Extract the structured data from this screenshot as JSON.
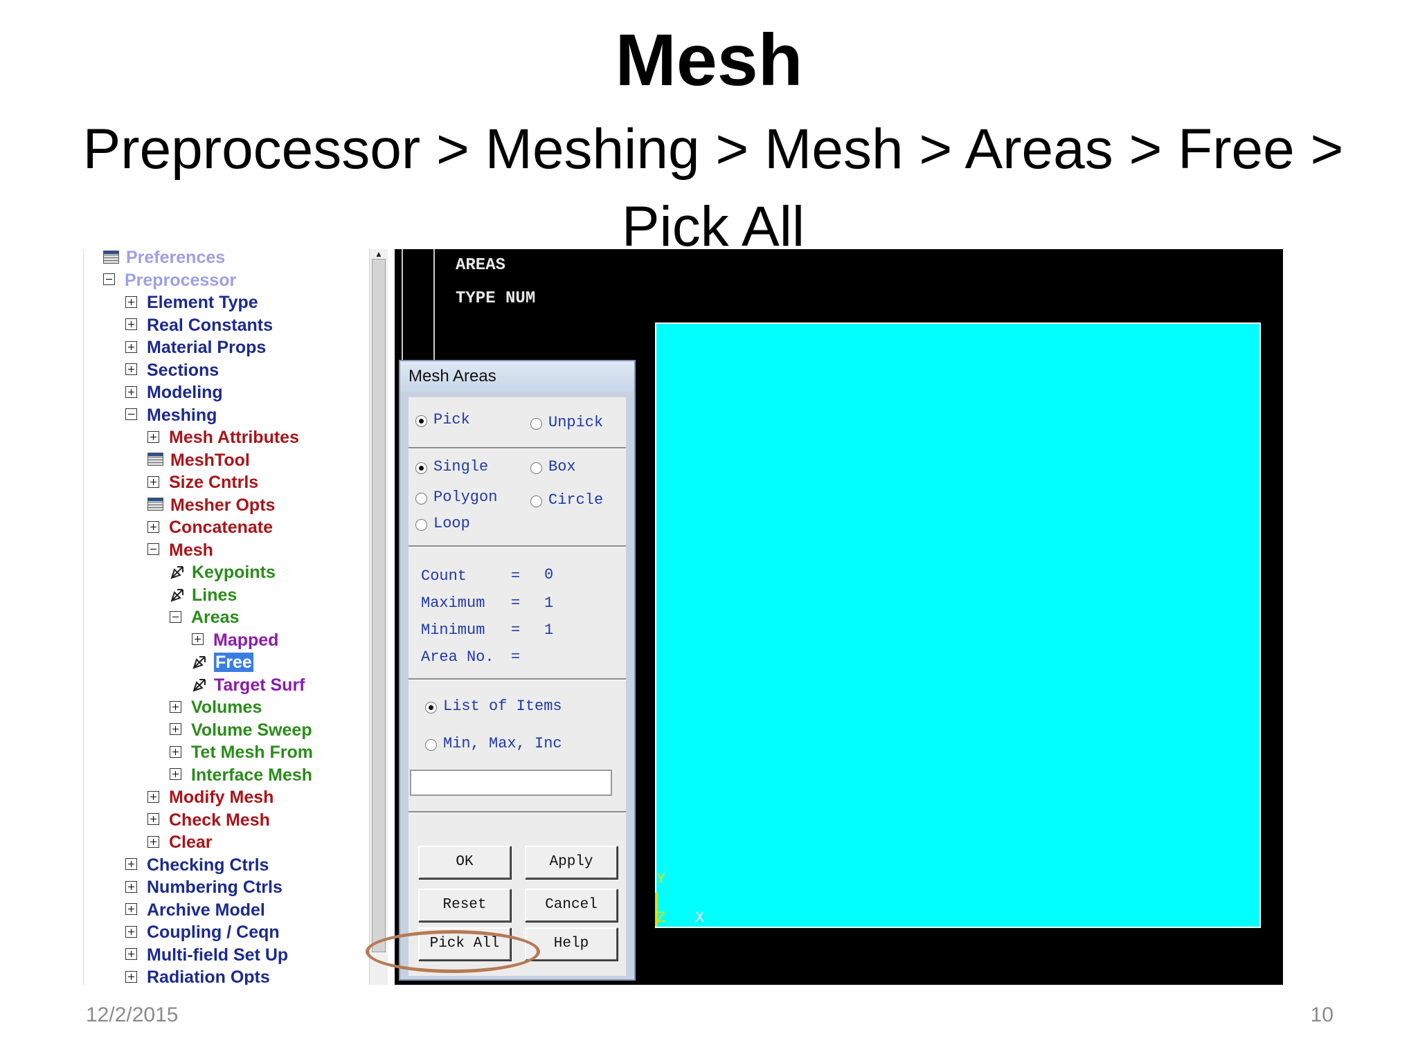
{
  "slide": {
    "title": "Mesh",
    "subtitle": "Preprocessor > Meshing > Mesh > Areas > Free > Pick All",
    "date": "12/2/2015",
    "page_number": "10"
  },
  "tree": {
    "items": [
      {
        "label": "Preferences",
        "icon": "tool-icon",
        "color": "lavender"
      },
      {
        "label": "Preprocessor",
        "icon": "minus-box-icon",
        "color": "lavender"
      },
      {
        "label": "Element Type",
        "icon": "plus-box-icon",
        "color": "navy"
      },
      {
        "label": "Real Constants",
        "icon": "plus-box-icon",
        "color": "navy"
      },
      {
        "label": "Material Props",
        "icon": "plus-box-icon",
        "color": "navy"
      },
      {
        "label": "Sections",
        "icon": "plus-box-icon",
        "color": "navy"
      },
      {
        "label": "Modeling",
        "icon": "plus-box-icon",
        "color": "navy"
      },
      {
        "label": "Meshing",
        "icon": "minus-box-icon",
        "color": "navy"
      },
      {
        "label": "Mesh Attributes",
        "icon": "plus-box-icon",
        "color": "red"
      },
      {
        "label": "MeshTool",
        "icon": "tool-icon",
        "color": "red"
      },
      {
        "label": "Size Cntrls",
        "icon": "plus-box-icon",
        "color": "red"
      },
      {
        "label": "Mesher Opts",
        "icon": "tool-icon",
        "color": "red"
      },
      {
        "label": "Concatenate",
        "icon": "plus-box-icon",
        "color": "red"
      },
      {
        "label": "Mesh",
        "icon": "minus-box-icon",
        "color": "red"
      },
      {
        "label": "Keypoints",
        "icon": "pick-arrow-icon",
        "color": "green"
      },
      {
        "label": "Lines",
        "icon": "pick-arrow-icon",
        "color": "green"
      },
      {
        "label": "Areas",
        "icon": "minus-box-icon",
        "color": "green"
      },
      {
        "label": "Mapped",
        "icon": "plus-box-icon",
        "color": "purple"
      },
      {
        "label": "Free",
        "icon": "pick-arrow-icon",
        "color": "purple",
        "selected": true
      },
      {
        "label": "Target Surf",
        "icon": "pick-arrow-icon",
        "color": "purple"
      },
      {
        "label": "Volumes",
        "icon": "plus-box-icon",
        "color": "green"
      },
      {
        "label": "Volume Sweep",
        "icon": "plus-box-icon",
        "color": "green"
      },
      {
        "label": "Tet Mesh From",
        "icon": "plus-box-icon",
        "color": "green"
      },
      {
        "label": "Interface Mesh",
        "icon": "plus-box-icon",
        "color": "green"
      },
      {
        "label": "Modify Mesh",
        "icon": "plus-box-icon",
        "color": "red"
      },
      {
        "label": "Check Mesh",
        "icon": "plus-box-icon",
        "color": "red"
      },
      {
        "label": "Clear",
        "icon": "plus-box-icon",
        "color": "red"
      },
      {
        "label": "Checking Ctrls",
        "icon": "plus-box-icon",
        "color": "navy"
      },
      {
        "label": "Numbering Ctrls",
        "icon": "plus-box-icon",
        "color": "navy"
      },
      {
        "label": "Archive Model",
        "icon": "plus-box-icon",
        "color": "navy"
      },
      {
        "label": "Coupling / Ceqn",
        "icon": "plus-box-icon",
        "color": "navy"
      },
      {
        "label": "Multi-field Set Up",
        "icon": "plus-box-icon",
        "color": "navy"
      },
      {
        "label": "Radiation Opts",
        "icon": "plus-box-icon",
        "color": "navy"
      }
    ]
  },
  "graphics": {
    "label_areas": "AREAS",
    "label_type_num": "TYPE NUM",
    "axis_y": "Y",
    "axis_z": "Z",
    "axis_x": "X",
    "area_color": "#00ffff"
  },
  "dialog": {
    "title": "Mesh Areas",
    "pick": "Pick",
    "unpick": "Unpick",
    "single": "Single",
    "box": "Box",
    "polygon": "Polygon",
    "circle": "Circle",
    "loop": "Loop",
    "count_label": "Count",
    "count_value": "0",
    "maximum_label": "Maximum",
    "maximum_value": "1",
    "minimum_label": "Minimum",
    "minimum_value": "1",
    "area_no_label": "Area No.",
    "equals": "=",
    "list_of_items": "List of Items",
    "min_max_inc": "Min, Max, Inc",
    "input_value": "",
    "buttons": {
      "ok": "OK",
      "apply": "Apply",
      "reset": "Reset",
      "cancel": "Cancel",
      "pick_all": "Pick All",
      "help": "Help"
    }
  },
  "colors": {
    "highlight_oval": "#b57a55",
    "selected_bg": "#3a7de0"
  }
}
